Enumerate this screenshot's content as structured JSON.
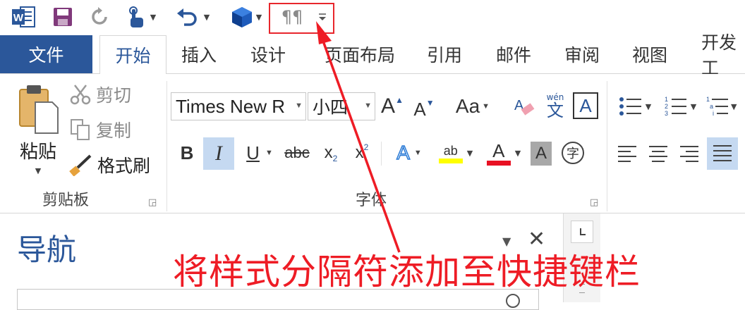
{
  "quick_access": {
    "word_icon_letter": "W",
    "pilcrow_label": "¶¶"
  },
  "tabs": [
    "文件",
    "开始",
    "插入",
    "设计",
    "页面布局",
    "引用",
    "邮件",
    "审阅",
    "视图",
    "开发工"
  ],
  "clipboard": {
    "paste_label": "粘贴",
    "cut_label": "剪切",
    "copy_label": "复制",
    "format_painter_label": "格式刷",
    "group_label": "剪贴板"
  },
  "font": {
    "font_name": "Times New R",
    "font_size": "小四",
    "change_case_label": "Aa",
    "phonetic_top": "wén",
    "phonetic_bottom": "文",
    "enclose_char": "字",
    "bold": "B",
    "italic": "I",
    "underline": "U",
    "strike": "abc",
    "sub": "x",
    "sub_mark": "2",
    "sup": "x",
    "sup_mark": "2",
    "text_effect": "A",
    "highlight_text": "ab",
    "font_color": "A",
    "char_shading": "A",
    "grow": "A",
    "shrink": "A",
    "border_char": "A",
    "group_label": "字体",
    "highlight_color": "#ffff00",
    "font_color_value": "#e81123"
  },
  "navigation": {
    "title": "导航"
  },
  "annotation": {
    "text": "将样式分隔符添加至快捷键栏"
  },
  "colors": {
    "accent": "#2b579a",
    "annotation": "#ee1c25"
  }
}
